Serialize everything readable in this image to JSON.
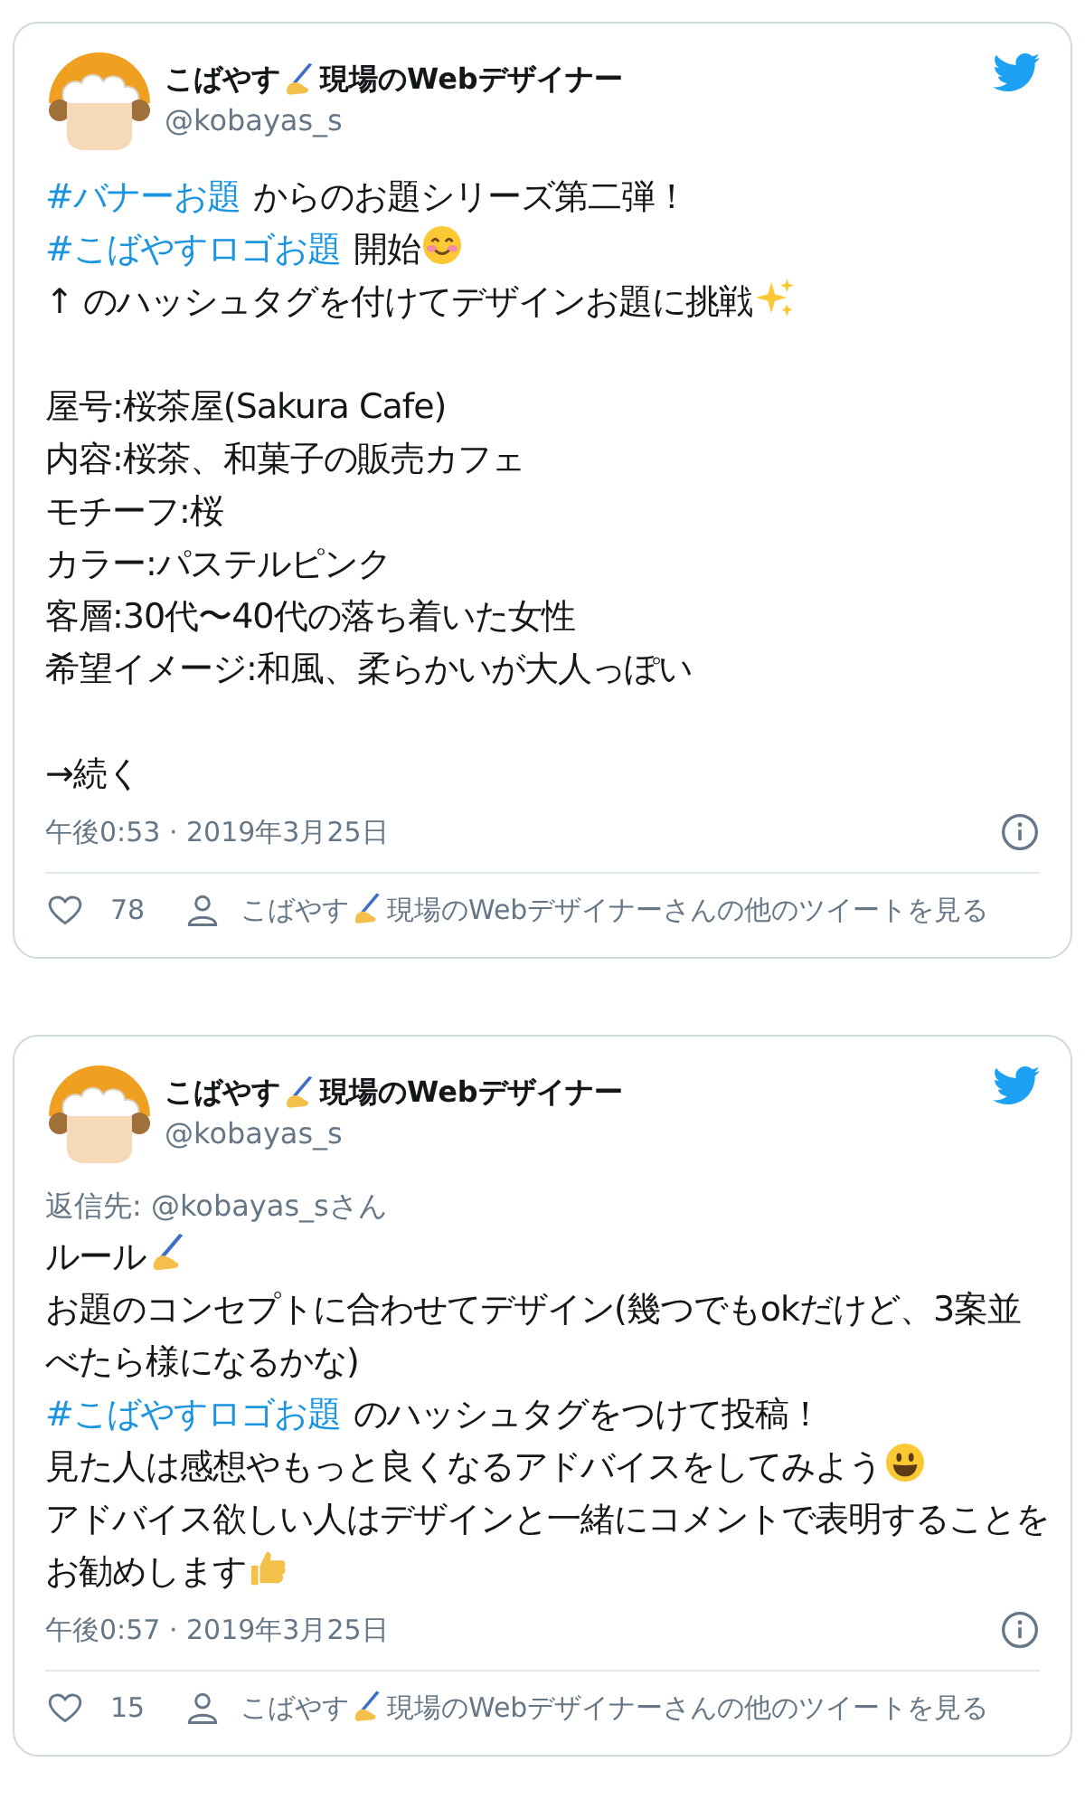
{
  "tweets": [
    {
      "author": {
        "name": [
          {
            "kind": "text",
            "text": "こばやす"
          },
          {
            "kind": "writing-hand"
          },
          {
            "kind": "text",
            "text": "現場のWebデザイナー"
          }
        ],
        "handle": "@kobayas_s"
      },
      "paragraphs": [
        [
          [
            {
              "kind": "hashtag",
              "text": "#バナーお題"
            },
            {
              "kind": "text",
              "text": "からのお題シリーズ第二弾！"
            }
          ],
          [
            {
              "kind": "hashtag",
              "text": "#こばやすロゴお題"
            },
            {
              "kind": "text",
              "text": "開始"
            },
            {
              "kind": "smile"
            }
          ],
          [
            {
              "kind": "text",
              "text": "↑ のハッシュタグを付けてデザインお題に挑戦"
            },
            {
              "kind": "sparkles"
            }
          ]
        ],
        [
          [
            {
              "kind": "text",
              "text": "屋号:桜茶屋(Sakura Cafe)"
            }
          ],
          [
            {
              "kind": "text",
              "text": "内容:桜茶、和菓子の販売カフェ"
            }
          ],
          [
            {
              "kind": "text",
              "text": "モチーフ:桜"
            }
          ],
          [
            {
              "kind": "text",
              "text": "カラー:パステルピンク"
            }
          ],
          [
            {
              "kind": "text",
              "text": "客層:30代〜40代の落ち着いた女性"
            }
          ],
          [
            {
              "kind": "text",
              "text": "希望イメージ:和風、柔らかいが大人っぽい"
            }
          ]
        ],
        [
          [
            {
              "kind": "text",
              "text": "→続く"
            }
          ]
        ]
      ],
      "timestamp": "午後0:53 · 2019年3月25日",
      "likes": "78",
      "more": [
        {
          "kind": "text",
          "text": "こばやす"
        },
        {
          "kind": "writing-hand"
        },
        {
          "kind": "text",
          "text": "現場のWebデザイナーさんの他のツイートを見る"
        }
      ]
    },
    {
      "author": {
        "name": [
          {
            "kind": "text",
            "text": "こばやす"
          },
          {
            "kind": "writing-hand"
          },
          {
            "kind": "text",
            "text": "現場のWebデザイナー"
          }
        ],
        "handle": "@kobayas_s"
      },
      "reply_to": "返信先: @kobayas_sさん",
      "paragraphs": [
        [
          [
            {
              "kind": "text",
              "text": "ルール"
            },
            {
              "kind": "writing-hand"
            }
          ],
          [
            {
              "kind": "text",
              "text": "お題のコンセプトに合わせてデザイン(幾つでもokだけど、3案並"
            }
          ],
          [
            {
              "kind": "text",
              "text": "べたら様になるかな)"
            }
          ],
          [
            {
              "kind": "hashtag",
              "text": "#こばやすロゴお題"
            },
            {
              "kind": "text",
              "text": "のハッシュタグをつけて投稿！"
            }
          ],
          [
            {
              "kind": "text",
              "text": "見た人は感想やもっと良くなるアドバイスをしてみよう"
            },
            {
              "kind": "grin"
            }
          ],
          [
            {
              "kind": "text",
              "text": "アドバイス欲しい人はデザインと一緒にコメントで表明することを"
            }
          ],
          [
            {
              "kind": "text",
              "text": "お勧めします"
            },
            {
              "kind": "thumbs-up"
            }
          ]
        ]
      ],
      "timestamp": "午後0:57 · 2019年3月25日",
      "likes": "15",
      "more": [
        {
          "kind": "text",
          "text": "こばやす"
        },
        {
          "kind": "writing-hand"
        },
        {
          "kind": "text",
          "text": "現場のWebデザイナーさんの他のツイートを見る"
        }
      ]
    }
  ]
}
